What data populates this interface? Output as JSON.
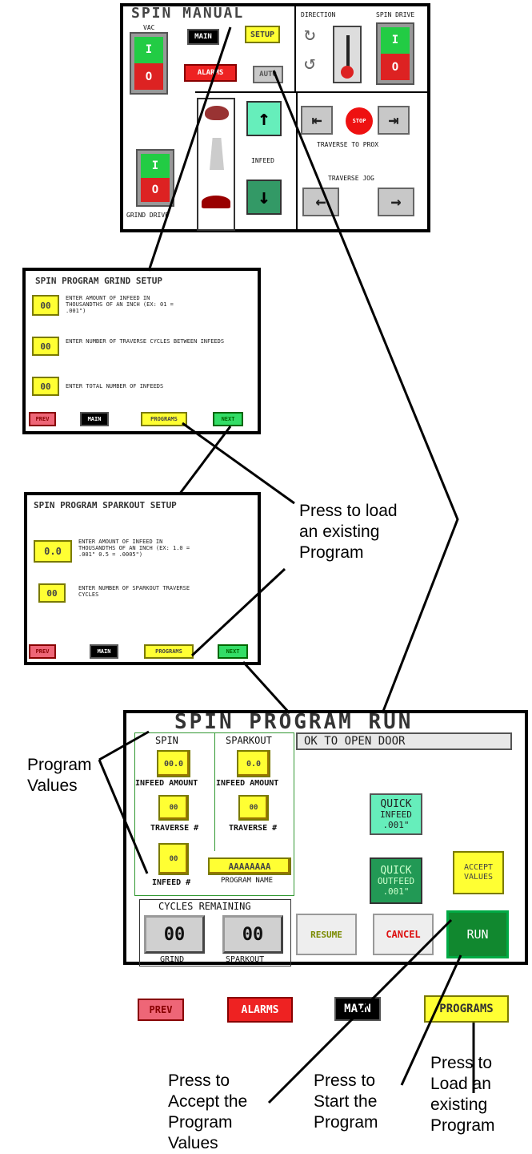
{
  "screen1": {
    "title": "SPIN MANUAL",
    "vac_label": "VAC",
    "main": "MAIN",
    "setup": "SETUP",
    "alarms": "ALARMS",
    "auto": "AUTO",
    "direction": "DIRECTION",
    "spin_drive": "SPIN DRIVE",
    "switch_on": "I",
    "switch_off": "O",
    "infeed": "INFEED",
    "stop": "STOP",
    "traverse_to_prox": "TRAVERSE TO PROX",
    "traverse_jog": "TRAVERSE JOG",
    "grind_drive": "GRIND DRIVE"
  },
  "screen2": {
    "title": "SPIN PROGRAM GRIND SETUP",
    "rows": [
      {
        "value": "00",
        "text": "ENTER AMOUNT OF INFEED IN THOUSANDTHS OF AN INCH (EX: 01 = .001\")"
      },
      {
        "value": "00",
        "text": "ENTER NUMBER OF TRAVERSE CYCLES BETWEEN INFEEDS"
      },
      {
        "value": "00",
        "text": "ENTER TOTAL NUMBER OF INFEEDS"
      }
    ],
    "prev": "PREV",
    "main": "MAIN",
    "programs": "PROGRAMS",
    "next": "NEXT"
  },
  "screen3": {
    "title": "SPIN PROGRAM SPARKOUT SETUP",
    "rows": [
      {
        "value": "0.0",
        "text": "ENTER AMOUNT OF INFEED IN THOUSANDTHS OF AN INCH (EX: 1.0 = .001\" 0.5 = .0005\")"
      },
      {
        "value": "00",
        "text": "ENTER NUMBER OF SPARKOUT TRAVERSE CYCLES"
      }
    ],
    "prev": "PREV",
    "main": "MAIN",
    "programs": "PROGRAMS",
    "next": "NEXT"
  },
  "screen4": {
    "title": "SPIN PROGRAM RUN",
    "ok_door": "OK TO OPEN DOOR",
    "spin": "SPIN",
    "sparkout": "SPARKOUT",
    "spin_infeed_amount": "00.0",
    "sparkout_infeed_amount": "0.0",
    "infeed_amount": "INFEED AMOUNT",
    "spin_traverse": "00",
    "sparkout_traverse": "00",
    "traverse_num": "TRAVERSE #",
    "spin_infeed_num": "00",
    "infeed_num": "INFEED #",
    "program_name_value": "AAAAAAAA",
    "program_name": "PROGRAM NAME",
    "quick_infeed": [
      "QUICK",
      "INFEED",
      ".001\""
    ],
    "quick_outfeed": [
      "QUICK",
      "OUTFEED",
      ".001\""
    ],
    "accept_values": [
      "ACCEPT",
      "VALUES"
    ],
    "cycles_remaining": "CYCLES REMAINING",
    "grind_count": "00",
    "sparkout_count": "00",
    "grind": "GRIND",
    "sparkout_label": "SPARKOUT",
    "resume": "RESUME",
    "cancel": "CANCEL",
    "run": "RUN",
    "prev": "PREV",
    "alarms": "ALARMS",
    "main": "MAIN",
    "programs": "PROGRAMS"
  },
  "annotations": {
    "load_program": [
      "Press to load",
      "an existing",
      "Program"
    ],
    "program_values": [
      "Program",
      "Values"
    ],
    "accept": [
      "Press to",
      "Accept the",
      "Program",
      "Values"
    ],
    "start": [
      "Press to",
      "Start the",
      "Program"
    ],
    "load": [
      "Press to",
      "Load an",
      "existing",
      "Program"
    ]
  },
  "colors": {
    "yellow": "#ffff33",
    "red": "#ee2222",
    "green": "#33dd66",
    "dark_green": "#11882f",
    "teal": "#66eebb"
  }
}
